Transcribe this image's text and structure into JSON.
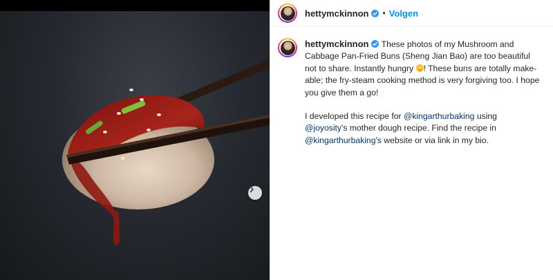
{
  "header": {
    "username": "hettymckinnon",
    "separator": "•",
    "follow_label": "Volgen"
  },
  "post": {
    "username": "hettymckinnon",
    "caption_part1": "These photos of my Mushroom and Cabbage Pan-Fried Buns (Sheng Jian Bao) are too beautiful not to share. Instantly hungry ",
    "caption_part2": "! These buns are totally make-able; the fry-steam cooking method is very forgiving too. I hope you give them a go!",
    "para2_text1": "I developed this recipe for ",
    "mention_kingarthur": "@kingarthurbaking",
    "para2_text2": " using ",
    "mention_joyosity": "@joyosity",
    "para2_text3": "'s mother dough recipe. Find the recipe in ",
    "mention_kingarthur_2": "@kingarthurbaking",
    "para2_text4": "'s website or via link in my bio."
  },
  "colors": {
    "link_blue": "#0095f6",
    "mention": "#00376b",
    "verified": "#3897f0"
  },
  "icons": {
    "verified": "verified-badge-icon",
    "next": "chevron-right-icon",
    "emoji": "drooling-face-emoji-icon"
  }
}
